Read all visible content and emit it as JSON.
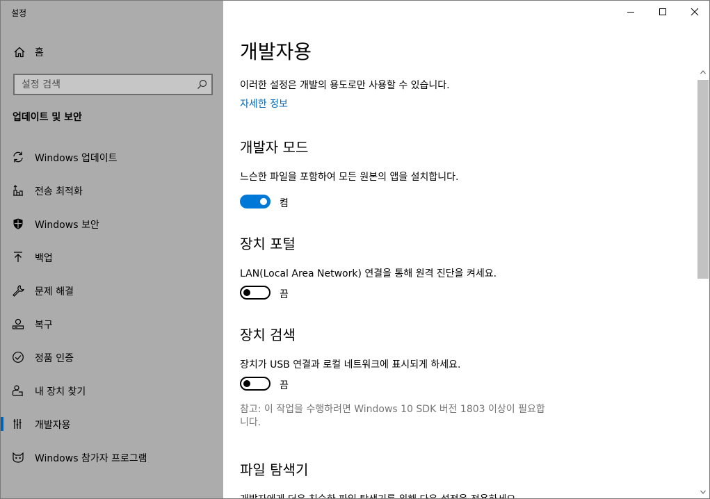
{
  "window": {
    "title": "설정"
  },
  "sidebar": {
    "home_label": "홈",
    "search_placeholder": "설정 검색",
    "section_title": "업데이트 및 보안",
    "items": [
      {
        "label": "Windows 업데이트",
        "icon": "sync-icon"
      },
      {
        "label": "전송 최적화",
        "icon": "delivery-optimization-icon"
      },
      {
        "label": "Windows 보안",
        "icon": "shield-icon"
      },
      {
        "label": "백업",
        "icon": "backup-arrow-icon"
      },
      {
        "label": "문제 해결",
        "icon": "wrench-icon"
      },
      {
        "label": "복구",
        "icon": "recovery-icon"
      },
      {
        "label": "정품 인증",
        "icon": "check-circle-icon"
      },
      {
        "label": "내 장치 찾기",
        "icon": "person-locate-icon"
      },
      {
        "label": "개발자용",
        "icon": "developer-tools-icon",
        "selected": true
      },
      {
        "label": "Windows 참가자 프로그램",
        "icon": "insider-cat-icon"
      }
    ]
  },
  "content": {
    "title": "개발자용",
    "intro": "이러한 설정은 개발의 용도로만 사용할 수 있습니다.",
    "more_info_link": "자세한 정보",
    "dev_mode": {
      "heading": "개발자 모드",
      "description": "느슨한 파일을 포함하여 모든 원본의 앱을 설치합니다.",
      "state": "켬"
    },
    "device_portal": {
      "heading": "장치 포털",
      "description": "LAN(Local Area Network) 연결을 통해 원격 진단을 켜세요.",
      "state": "끔"
    },
    "device_discovery": {
      "heading": "장치 검색",
      "description": "장치가 USB 연결과 로컬 네트워크에 표시되게 하세요.",
      "state": "끔",
      "note": "참고: 이 작업을 수행하려면 Windows 10 SDK 버전 1803 이상이 필요합니다."
    },
    "file_explorer": {
      "heading": "파일 탐색기",
      "description": "개발자에게 더욱 친숙한 파일 탐색기를 위해 다음 설정을 적용하세요."
    }
  },
  "colors": {
    "sidebar_bg": "#acacac",
    "accent": "#0078d7",
    "link": "#0067b8"
  }
}
